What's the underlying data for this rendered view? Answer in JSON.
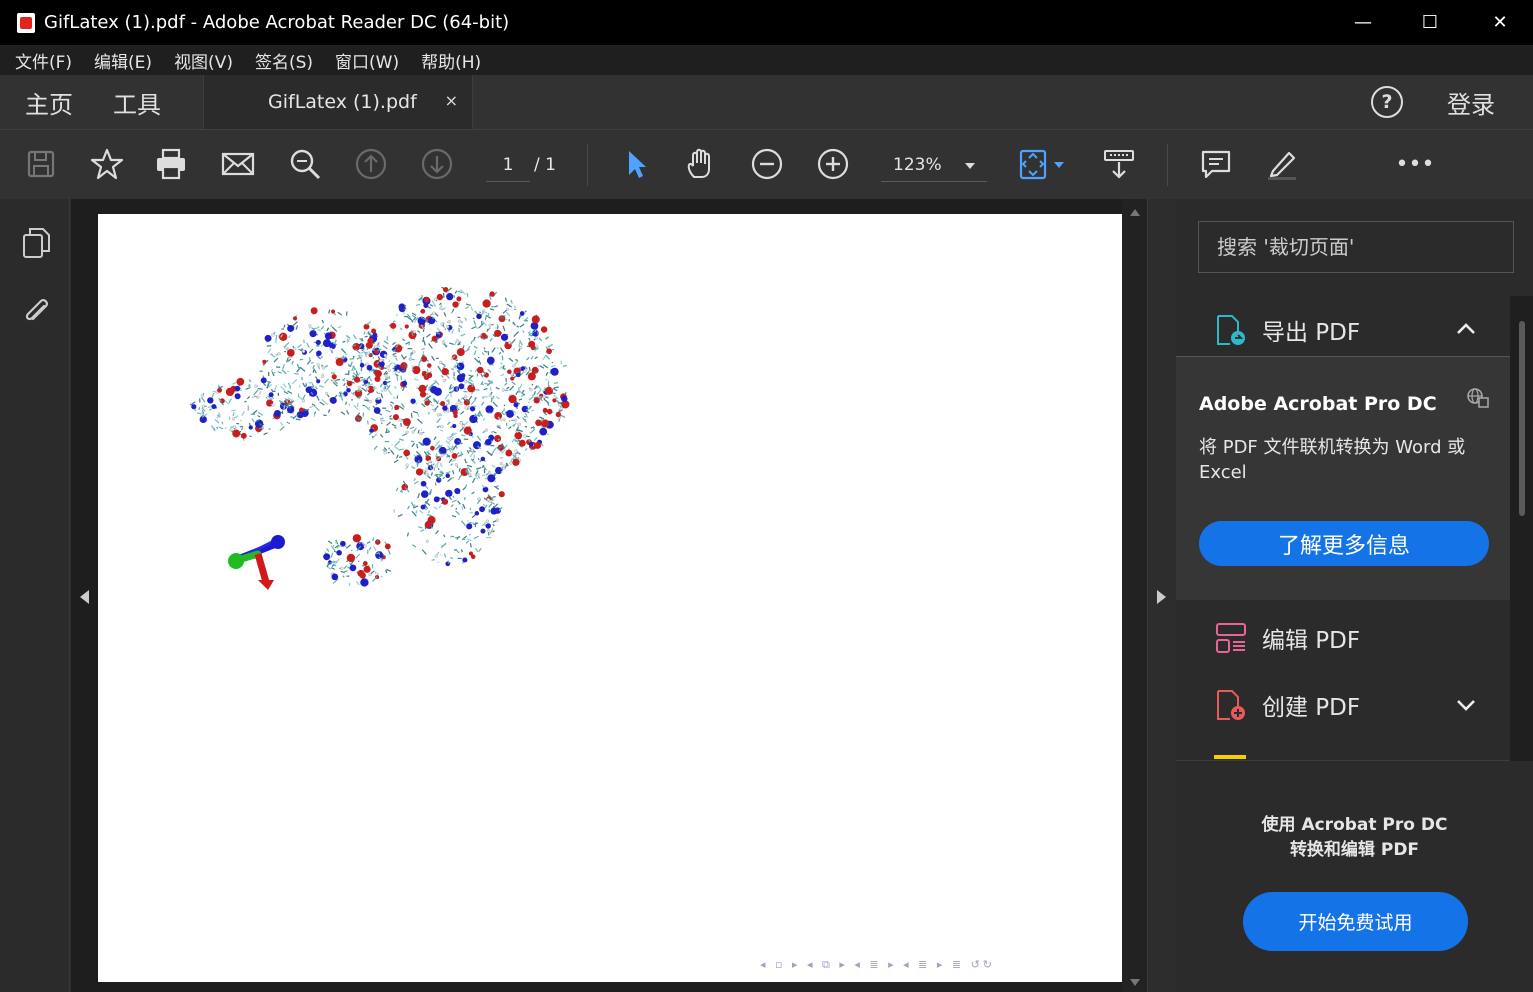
{
  "window": {
    "title": "GifLatex (1).pdf - Adobe Acrobat Reader DC (64-bit)",
    "minimize": "—",
    "maximize": "☐",
    "close": "✕"
  },
  "menu": [
    "文件(F)",
    "编辑(E)",
    "视图(V)",
    "签名(S)",
    "窗口(W)",
    "帮助(H)"
  ],
  "tabs": {
    "home": "主页",
    "tools": "工具",
    "document": "GifLatex (1).pdf",
    "close": "×",
    "help": "?",
    "login": "登录"
  },
  "toolbar": {
    "page_current": "1",
    "page_total": "/ 1",
    "zoom": "123%",
    "more": "•••"
  },
  "viewer": {
    "nav_strip": "◂ ▫ ▸ ◂ ⧉ ▸ ◂ ≣ ▸ ◂ ≣ ▸ ≣ ↺↻"
  },
  "right_panel": {
    "search_placeholder": "搜索 '裁切页面'",
    "export_pdf": "导出 PDF",
    "promo_title": "Adobe Acrobat Pro DC",
    "promo_desc": "将 PDF 文件联机转换为 Word 或 Excel",
    "promo_button": "了解更多信息",
    "edit_pdf": "编辑 PDF",
    "create_pdf": "创建 PDF",
    "bottom_line1": "使用 Acrobat Pro DC",
    "bottom_line2": "转换和编辑 PDF",
    "trial_button": "开始免费试用"
  },
  "colors": {
    "accent": "#1473e6",
    "export_icon": "#2fb8c9",
    "edit_icon": "#e8649a",
    "create_icon": "#ea5a5a"
  }
}
